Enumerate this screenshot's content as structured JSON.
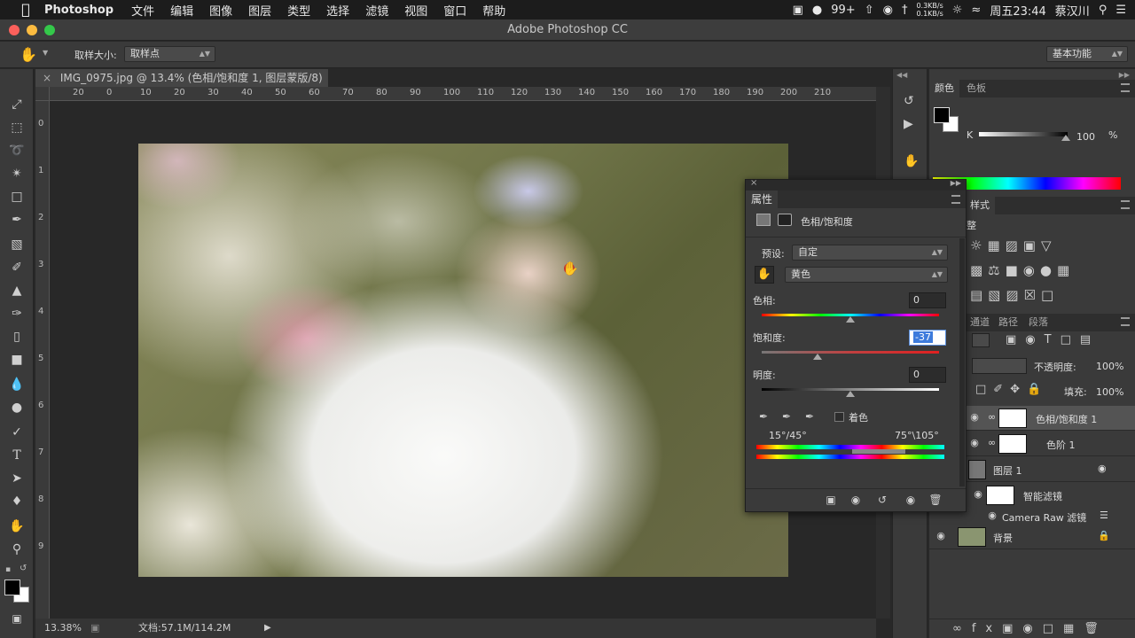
{
  "menubar": {
    "app": "Photoshop",
    "items": [
      "文件",
      "编辑",
      "图像",
      "图层",
      "类型",
      "选择",
      "滤镜",
      "视图",
      "窗口",
      "帮助"
    ],
    "battery": "99+",
    "net_up": "0.3KB/s",
    "net_down": "0.1KB/s",
    "clock": "周五23:44",
    "user": "蔡汉川"
  },
  "window": {
    "title": "Adobe Photoshop CC"
  },
  "options": {
    "sample_size_label": "取样大小:",
    "sample_size_value": "取样点",
    "workspace": "基本功能"
  },
  "document": {
    "tab_title": "IMG_0975.jpg @ 13.4% (色相/饱和度 1, 图层蒙版/8) *",
    "zoom": "13.38%",
    "doc_info": "文档:57.1M/114.2M",
    "hruler": [
      "20",
      "0",
      "10",
      "20",
      "30",
      "40",
      "50",
      "60",
      "70",
      "80",
      "90",
      "100",
      "110",
      "120",
      "130",
      "140",
      "150",
      "160",
      "170",
      "180",
      "190",
      "200",
      "210"
    ],
    "vruler": [
      "0",
      "1",
      "2",
      "3",
      "4",
      "5",
      "6",
      "7",
      "8",
      "9"
    ]
  },
  "color_panel": {
    "tabs": [
      "颜色",
      "色板"
    ],
    "channel": "K",
    "value": "100",
    "unit": "%"
  },
  "styles_panel": {
    "tab": "样式",
    "tab2": "整"
  },
  "layers_panel": {
    "tabs": [
      "通道",
      "路径",
      "段落"
    ],
    "opacity_label": "不透明度:",
    "opacity": "100%",
    "fill_label": "填充:",
    "fill": "100%",
    "layers": [
      {
        "name": "色相/饱和度 1",
        "selected": true
      },
      {
        "name": "色阶 1",
        "selected": false
      },
      {
        "name": "图层 1",
        "selected": false
      },
      {
        "name": "智能滤镜",
        "selected": false
      },
      {
        "name": "Camera Raw 滤镜",
        "selected": false
      },
      {
        "name": "背景",
        "selected": false
      }
    ]
  },
  "properties": {
    "tab": "属性",
    "type": "色相/饱和度",
    "preset_label": "预设:",
    "preset": "自定",
    "channel": "黄色",
    "hue_label": "色相:",
    "hue": "0",
    "saturation_label": "饱和度:",
    "saturation": "-37",
    "lightness_label": "明度:",
    "lightness": "0",
    "colorize_label": "着色",
    "range_left": "15°/45°",
    "range_right": "75°\\105°"
  }
}
